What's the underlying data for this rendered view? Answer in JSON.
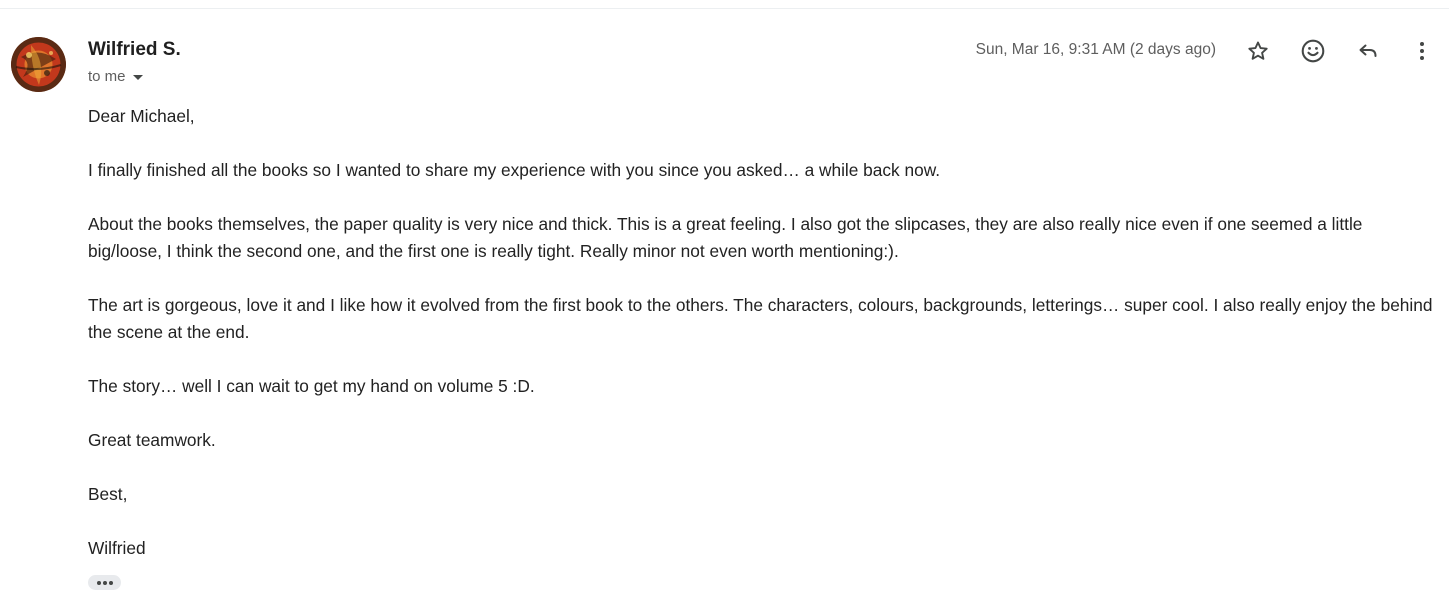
{
  "message": {
    "sender_name": "Wilfried S.",
    "recipient_label": "to me",
    "timestamp": "Sun, Mar 16, 9:31 AM (2 days ago)",
    "body_paragraphs": [
      "Dear Michael,",
      "I finally finished all the books so I wanted to share my experience with you since you asked… a while back now.",
      "About the books themselves, the paper quality is very nice and thick. This is a great feeling. I also got the slipcases, they are also really nice even if one seemed a little big/loose, I think the second one, and the first one is really tight. Really minor not even worth mentioning:).",
      "The art is gorgeous, love it and I like how it evolved from the first book to the others. The characters, colours, backgrounds, letterings… super cool. I also really enjoy the behind the scene at the end.",
      "The story… well I can wait to get my hand on volume 5 :D.",
      "Great teamwork.",
      "Best,",
      "Wilfried"
    ]
  },
  "icons": {
    "avatar": "sender-avatar-image",
    "recipients_toggle": "caret-down-icon",
    "star": "star-outline-icon",
    "emoji": "smiley-face-icon",
    "reply": "reply-arrow-icon",
    "more": "vertical-dots-icon",
    "trimmed_content": "ellipsis-icon"
  },
  "colors": {
    "icon": "#444746",
    "secondary_text": "#5e5e5e",
    "body_text": "#222222",
    "divider": "#eceff1",
    "ellipsis_bg": "#e8eaed"
  }
}
